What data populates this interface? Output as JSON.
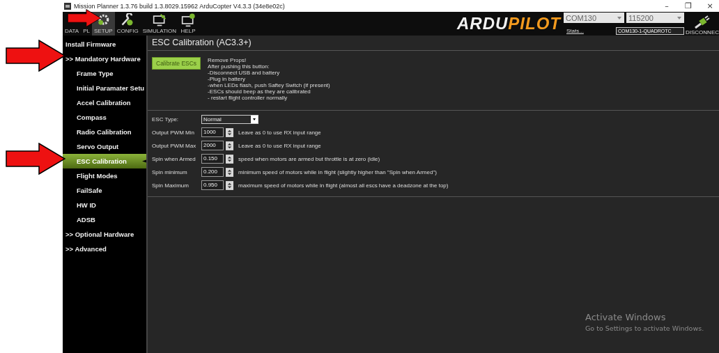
{
  "window": {
    "title": "Mission Planner 1.3.76 build 1.3.8029.15962 ArduCopter V4.3.3 (34e8e02c)",
    "controls": [
      "–",
      "❐",
      "×"
    ]
  },
  "toolbar": {
    "tabs": [
      {
        "label": "DATA",
        "selected": false
      },
      {
        "label": "PL",
        "selected": false
      },
      {
        "label": "SETUP",
        "selected": true
      },
      {
        "label": "CONFIG",
        "selected": false
      },
      {
        "label": "SIMULATION",
        "selected": false
      },
      {
        "label": "HELP",
        "selected": false
      }
    ],
    "logo": [
      "ARDU",
      "PILOT"
    ],
    "port": "COM130",
    "baud": "115200",
    "stats_link": "Stats...",
    "link": "COM130-1-QUADROTC",
    "disconnect": "DISCONNEC"
  },
  "sidebar": {
    "items": [
      {
        "label": "Install Firmware",
        "selected": false
      },
      {
        "label": ">> Mandatory Hardware",
        "selected": false,
        "children": [
          {
            "label": "Frame Type",
            "selected": false
          },
          {
            "label": "Initial Paramater Setu",
            "selected": false
          },
          {
            "label": "Accel Calibration",
            "selected": false
          },
          {
            "label": "Compass",
            "selected": false
          },
          {
            "label": "Radio Calibration",
            "selected": false
          },
          {
            "label": "Servo Output",
            "selected": false
          },
          {
            "label": "ESC Calibration",
            "selected": true
          },
          {
            "label": "Flight Modes",
            "selected": false
          },
          {
            "label": "FailSafe",
            "selected": false
          },
          {
            "label": "HW ID",
            "selected": false
          },
          {
            "label": "ADSB",
            "selected": false
          }
        ]
      },
      {
        "label": ">> Optional Hardware",
        "selected": false
      },
      {
        "label": ">> Advanced",
        "selected": false
      }
    ]
  },
  "page": {
    "title": "ESC Calibration (AC3.3+)",
    "button": "Calibrate ESCs",
    "instructions": [
      "Remove Props!",
      "After pushing this button:",
      "-Disconnect USB and battery",
      "-Plug in battery",
      "-when LEDs flash, push Saftey Switch (if present)",
      "-ESCs should beep as they are calibrated",
      "- restart flight controller normally"
    ],
    "fields": [
      {
        "kind": "select",
        "label": "ESC Type:",
        "value": "Normal"
      },
      {
        "kind": "spinner",
        "label": "Output PWM Min",
        "value": "1000",
        "hint": "Leave as 0 to use RX input range"
      },
      {
        "kind": "spinner",
        "label": "Output PWM Max",
        "value": "2000",
        "hint": "Leave as 0 to use RX input range"
      },
      {
        "kind": "spinner",
        "label": "Spin when Armed",
        "value": "0.150",
        "hint": "speed when motors are armed but throttle is at zero (idle)"
      },
      {
        "kind": "spinner",
        "label": "Spin minimum",
        "value": "0.200",
        "hint": "minimum speed of motors while in flight (slightly higher than \"Spin when Armed\")"
      },
      {
        "kind": "spinner",
        "label": "Spin Maximum",
        "value": "0.950",
        "hint": "maximum speed of motors while in flight (almost all escs have a deadzone at the top)"
      }
    ]
  },
  "os_notice": {
    "title": "Activate Windows",
    "text": "Go to Settings to activate Windows."
  }
}
